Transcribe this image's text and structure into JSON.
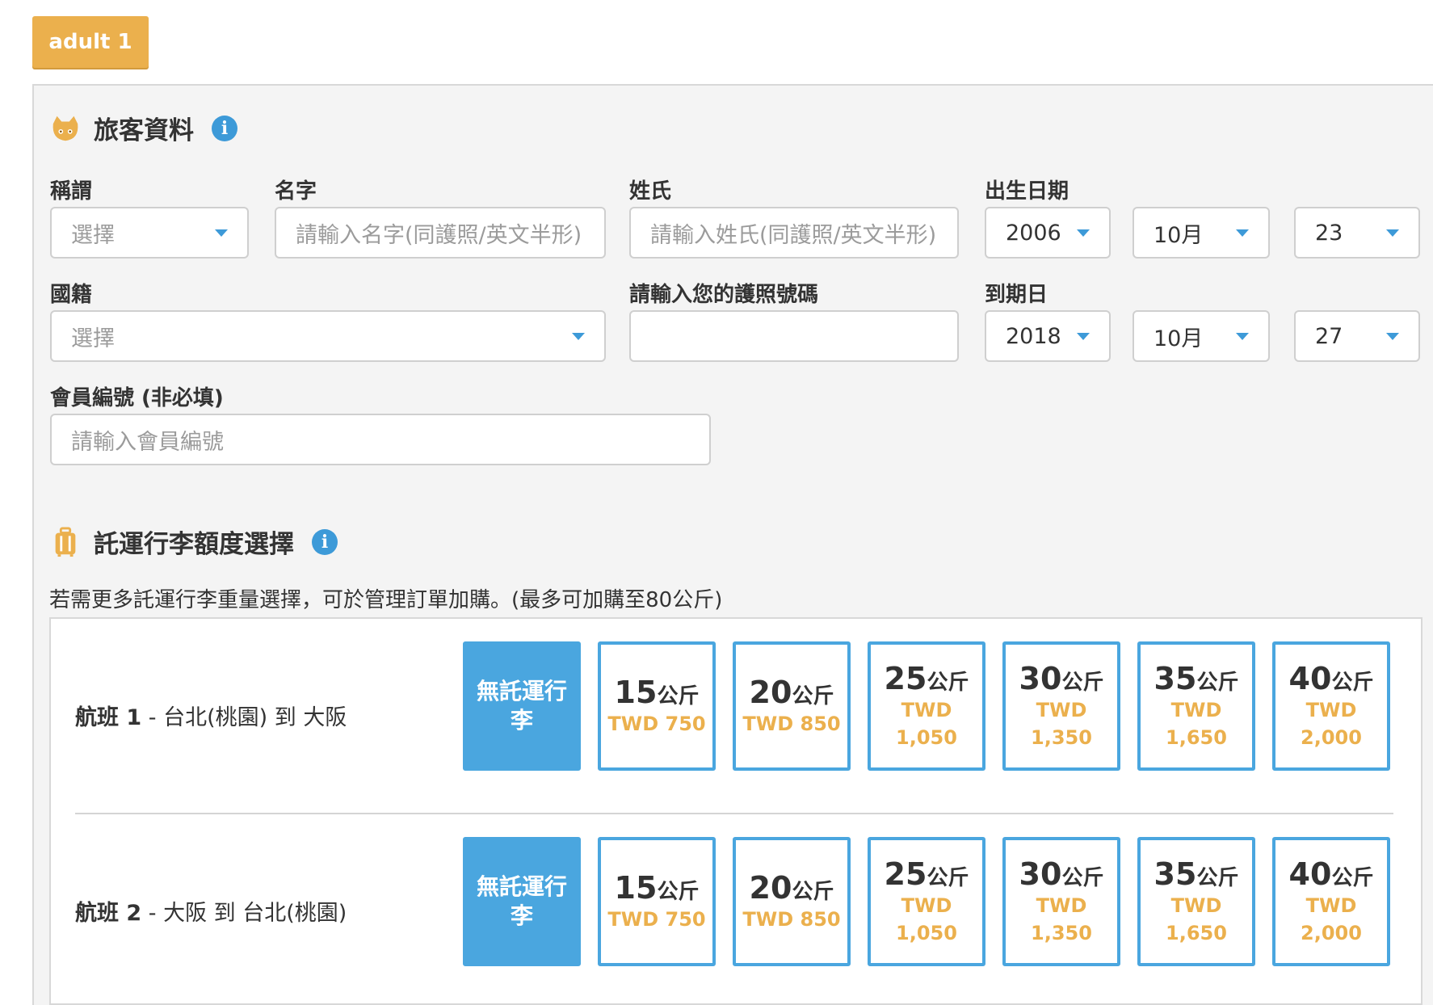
{
  "tab_label": "adult 1",
  "passenger_section": {
    "title": "旅客資料",
    "info_glyph": "i"
  },
  "labels": {
    "title": "稱謂",
    "first_name": "名字",
    "last_name": "姓氏",
    "dob": "出生日期",
    "nationality": "國籍",
    "passport": "請輸入您的護照號碼",
    "expiry": "到期日",
    "member": "會員編號 (非必填)"
  },
  "fields": {
    "title_select": "選擇",
    "first_name_placeholder": "請輸入名字(同護照/英文半形)",
    "last_name_placeholder": "請輸入姓氏(同護照/英文半形)",
    "dob_year": "2006",
    "dob_month": "10月",
    "dob_day": "23",
    "nationality_select": "選擇",
    "passport_value": "",
    "exp_year": "2018",
    "exp_month": "10月",
    "exp_day": "27",
    "member_placeholder": "請輸入會員編號"
  },
  "baggage_section": {
    "title": "託運行李額度選擇",
    "info_glyph": "i",
    "note": "若需更多託運行李重量選擇，可於管理訂單加購。(最多可加購至80公斤)",
    "no_baggage_label": "無託運行李",
    "flights": [
      {
        "name": "航班 1",
        "route": " - 台北(桃園) 到 大阪"
      },
      {
        "name": "航班 2",
        "route": " - 大阪 到 台北(桃園)"
      }
    ],
    "options": [
      {
        "weight": "15",
        "unit": "公斤",
        "price_line1": "TWD 750",
        "price_line2": ""
      },
      {
        "weight": "20",
        "unit": "公斤",
        "price_line1": "TWD 850",
        "price_line2": ""
      },
      {
        "weight": "25",
        "unit": "公斤",
        "price_line1": "TWD",
        "price_line2": "1,050"
      },
      {
        "weight": "30",
        "unit": "公斤",
        "price_line1": "TWD",
        "price_line2": "1,350"
      },
      {
        "weight": "35",
        "unit": "公斤",
        "price_line1": "TWD",
        "price_line2": "1,650"
      },
      {
        "weight": "40",
        "unit": "公斤",
        "price_line1": "TWD",
        "price_line2": "2,000"
      }
    ]
  },
  "colors": {
    "accent_orange": "#ebb04d",
    "accent_blue": "#4aa6df"
  }
}
